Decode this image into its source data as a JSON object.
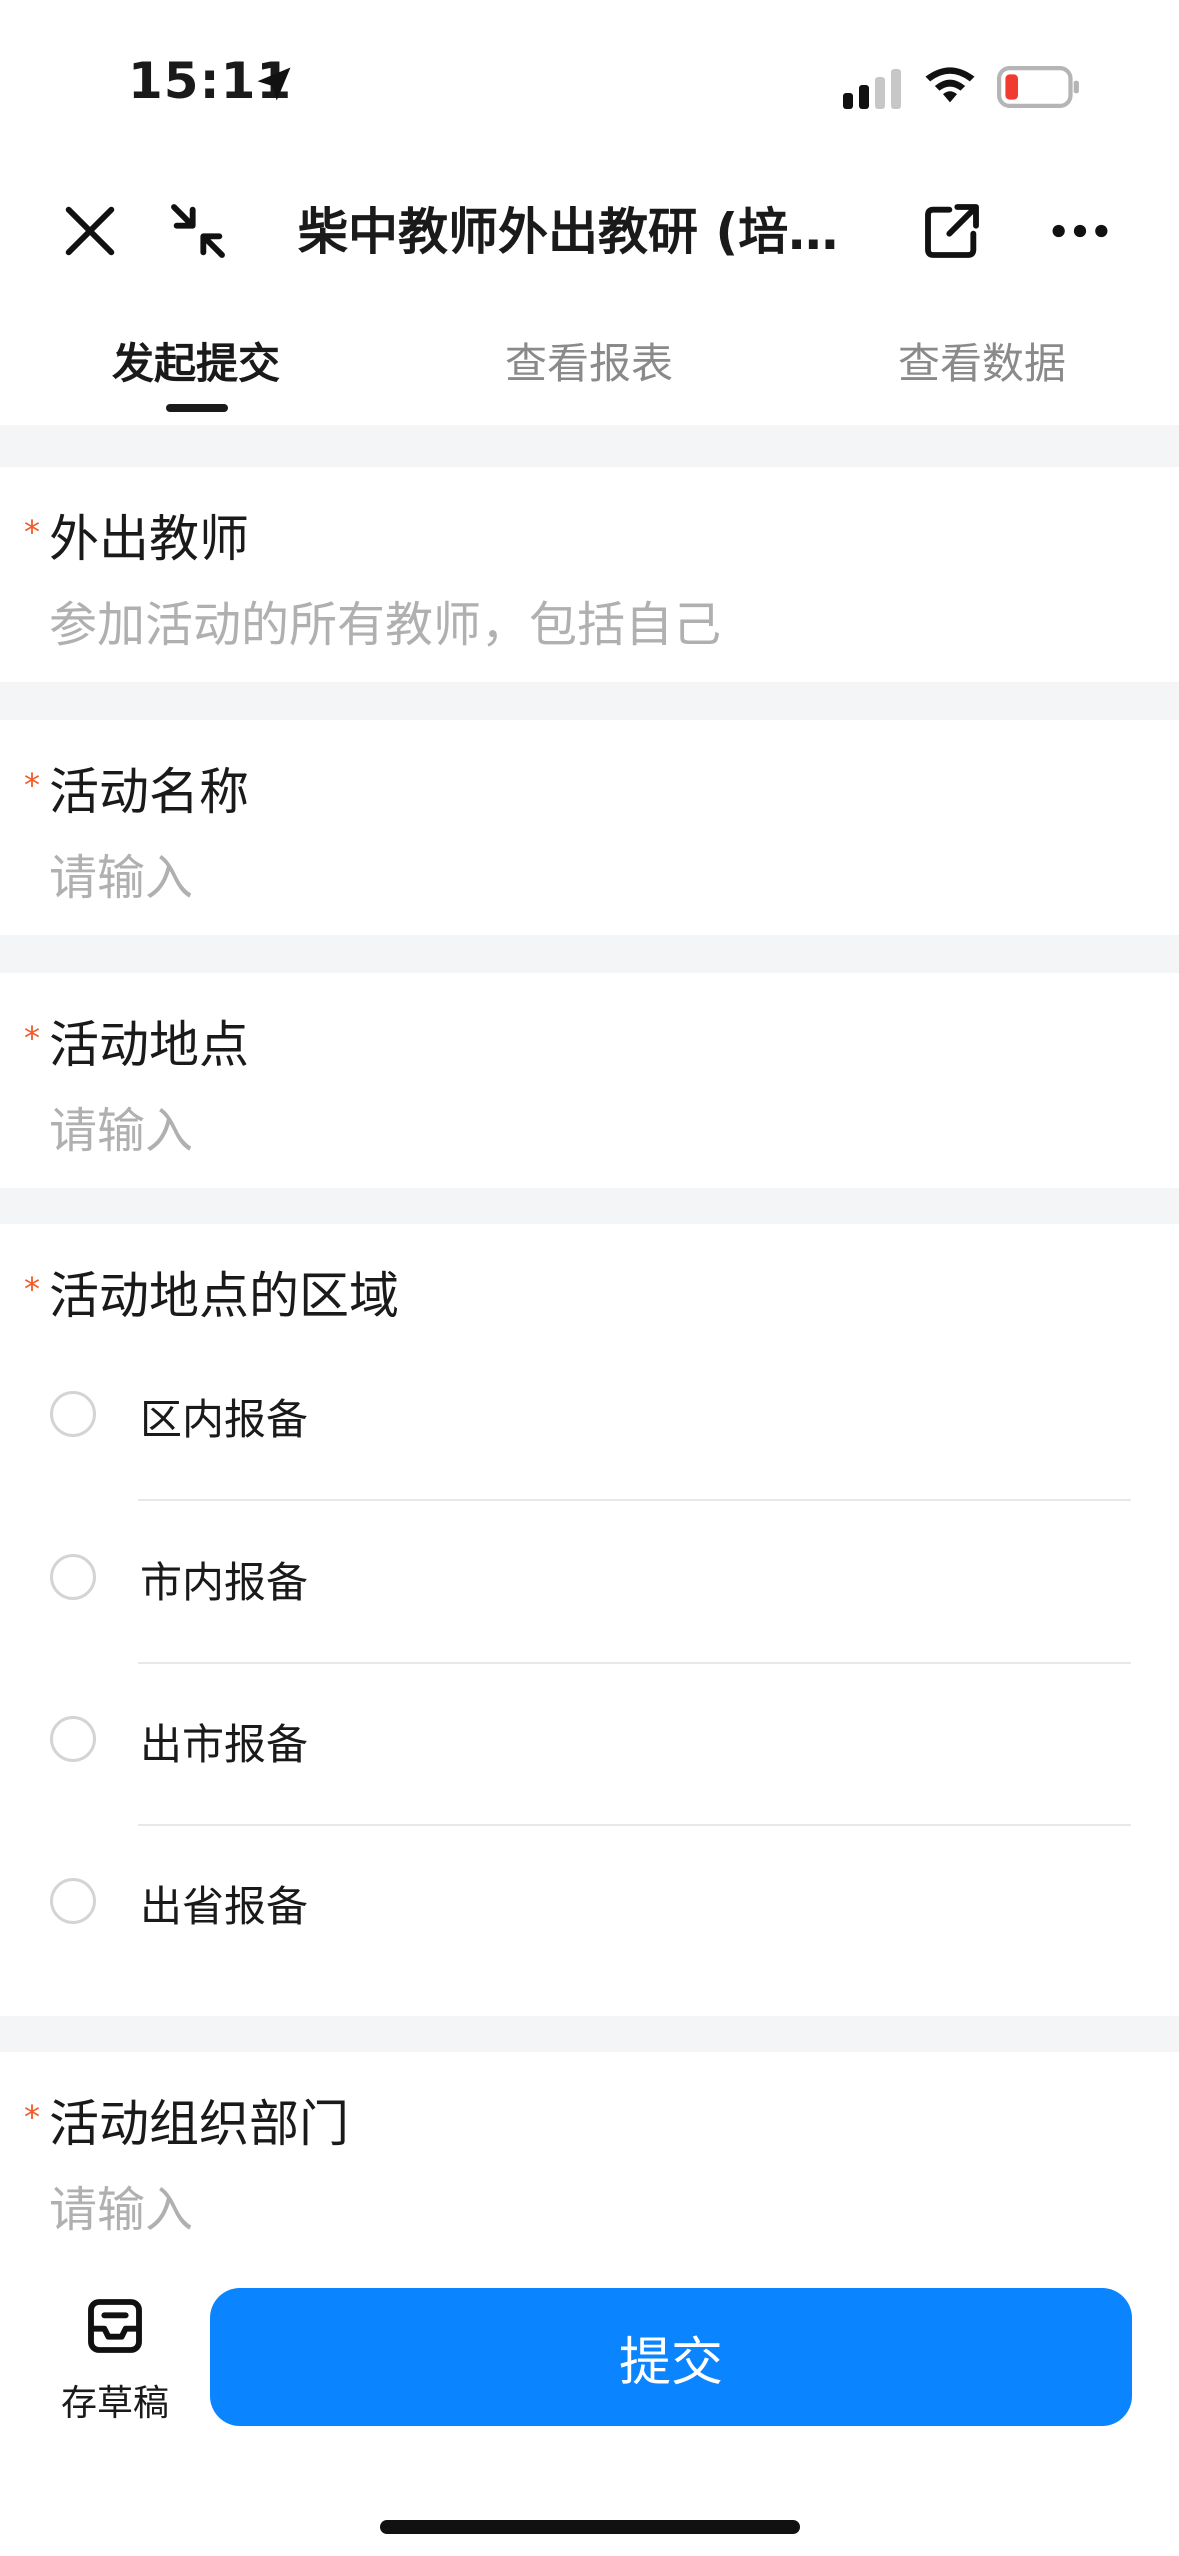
{
  "status_bar": {
    "time": "15:11",
    "battery_color": "#f23b30"
  },
  "nav": {
    "title": "柴中教师外出教研 (培训) 报备",
    "icons": [
      "close-icon",
      "minimize-icon",
      "share-icon",
      "more-icon"
    ]
  },
  "tabs": [
    {
      "label": "发起提交",
      "active": true
    },
    {
      "label": "查看报表",
      "active": false
    },
    {
      "label": "查看数据",
      "active": false
    }
  ],
  "fields": {
    "teachers": {
      "label": "外出教师",
      "placeholder": "参加活动的所有教师，包括自己",
      "required": "*"
    },
    "activity_name": {
      "label": "活动名称",
      "placeholder": "请输入",
      "required": "*"
    },
    "activity_location": {
      "label": "活动地点",
      "placeholder": "请输入",
      "required": "*"
    },
    "location_region": {
      "label": "活动地点的区域",
      "required": "*",
      "options": [
        "区内报备",
        "市内报备",
        "出市报备",
        "出省报备"
      ]
    },
    "organizer": {
      "label": "活动组织部门",
      "placeholder": "请输入",
      "required": "*"
    }
  },
  "bottom_bar": {
    "draft_label": "存草稿",
    "submit_label": "提交",
    "accent_color": "#0a84ff"
  }
}
